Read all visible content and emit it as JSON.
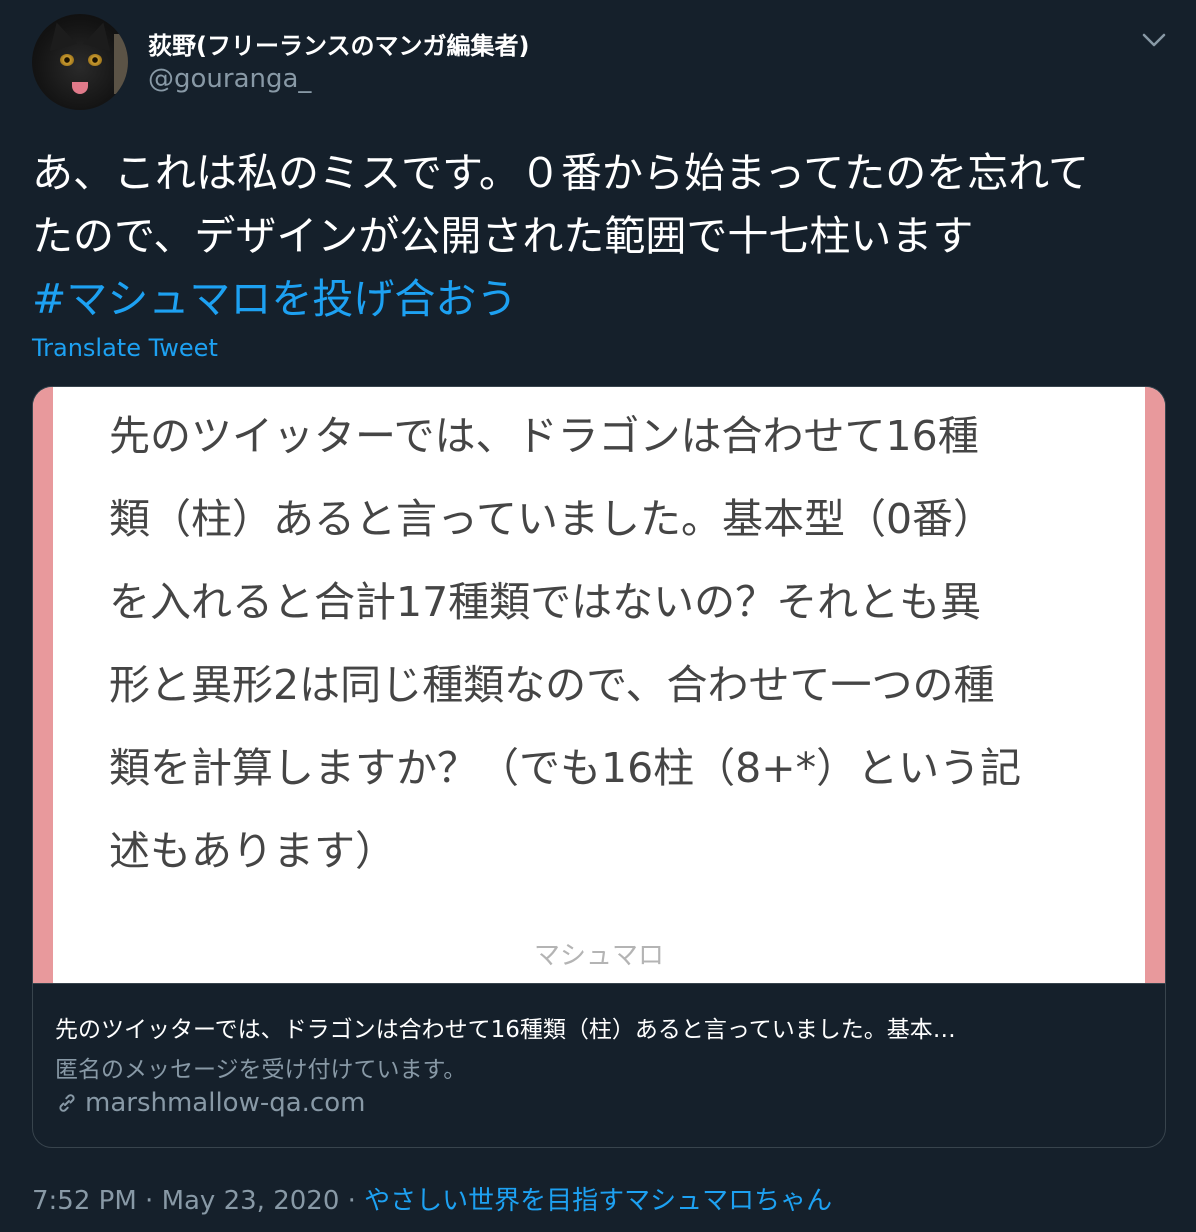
{
  "author": {
    "display_name": "荻野(フリーランスのマンガ編集者)",
    "handle": "@gouranga_"
  },
  "tweet": {
    "line1": "あ、これは私のミスです。０番から始まってたのを忘れて",
    "line2": "たので、デザインが公開された範囲で十七柱います",
    "hashtag": "#マシュマロを投げ合おう",
    "translate_label": "Translate Tweet"
  },
  "card": {
    "image_lines": [
      "先のツイッターでは、ドラゴンは合わせて16種",
      "類（柱）あると言っていました。基本型（0番）",
      "を入れると合計17種類ではないの？それとも異",
      "形と異形2は同じ種類なので、合わせて一つの種",
      "類を計算しますか？（でも16柱（8+*）という記",
      "述もあります）"
    ],
    "image_footer": "マシュマロ",
    "title": "先のツイッターでは、ドラゴンは合わせて16種類（柱）あると言っていました。基本…",
    "description": "匿名のメッセージを受け付けています。",
    "domain": "marshmallow-qa.com"
  },
  "footer": {
    "time": "7:52 PM",
    "separator1": " · ",
    "date": "May 23, 2020",
    "separator2": " · ",
    "source": "やさしい世界を目指すマシュマロちゃん"
  },
  "icons": [
    "avatar",
    "chevron-down-icon",
    "link-icon"
  ],
  "colors": {
    "background": "#15202b",
    "accent": "#1da1f2",
    "secondary_text": "#8899a6",
    "border": "#38444d",
    "card_stripe": "#e8999c"
  }
}
